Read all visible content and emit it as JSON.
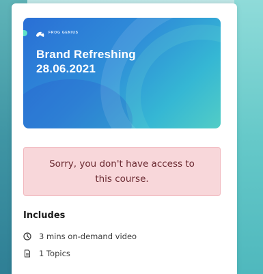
{
  "banner": {
    "brand": "FROG GENIUS",
    "title_line1": "Brand Refreshing",
    "title_line2": "28.06.2021"
  },
  "alert": {
    "message": "Sorry, you don't have access to this course."
  },
  "includes": {
    "heading": "Includes",
    "items": [
      {
        "icon": "clock-icon",
        "label": "3 mins on-demand video"
      },
      {
        "icon": "document-icon",
        "label": "1 Topics"
      }
    ]
  },
  "colors": {
    "alert_bg": "#f8d7da",
    "alert_text": "#6b2a31",
    "banner_blue": "#2a6fd6",
    "banner_teal": "#52cdc6"
  }
}
